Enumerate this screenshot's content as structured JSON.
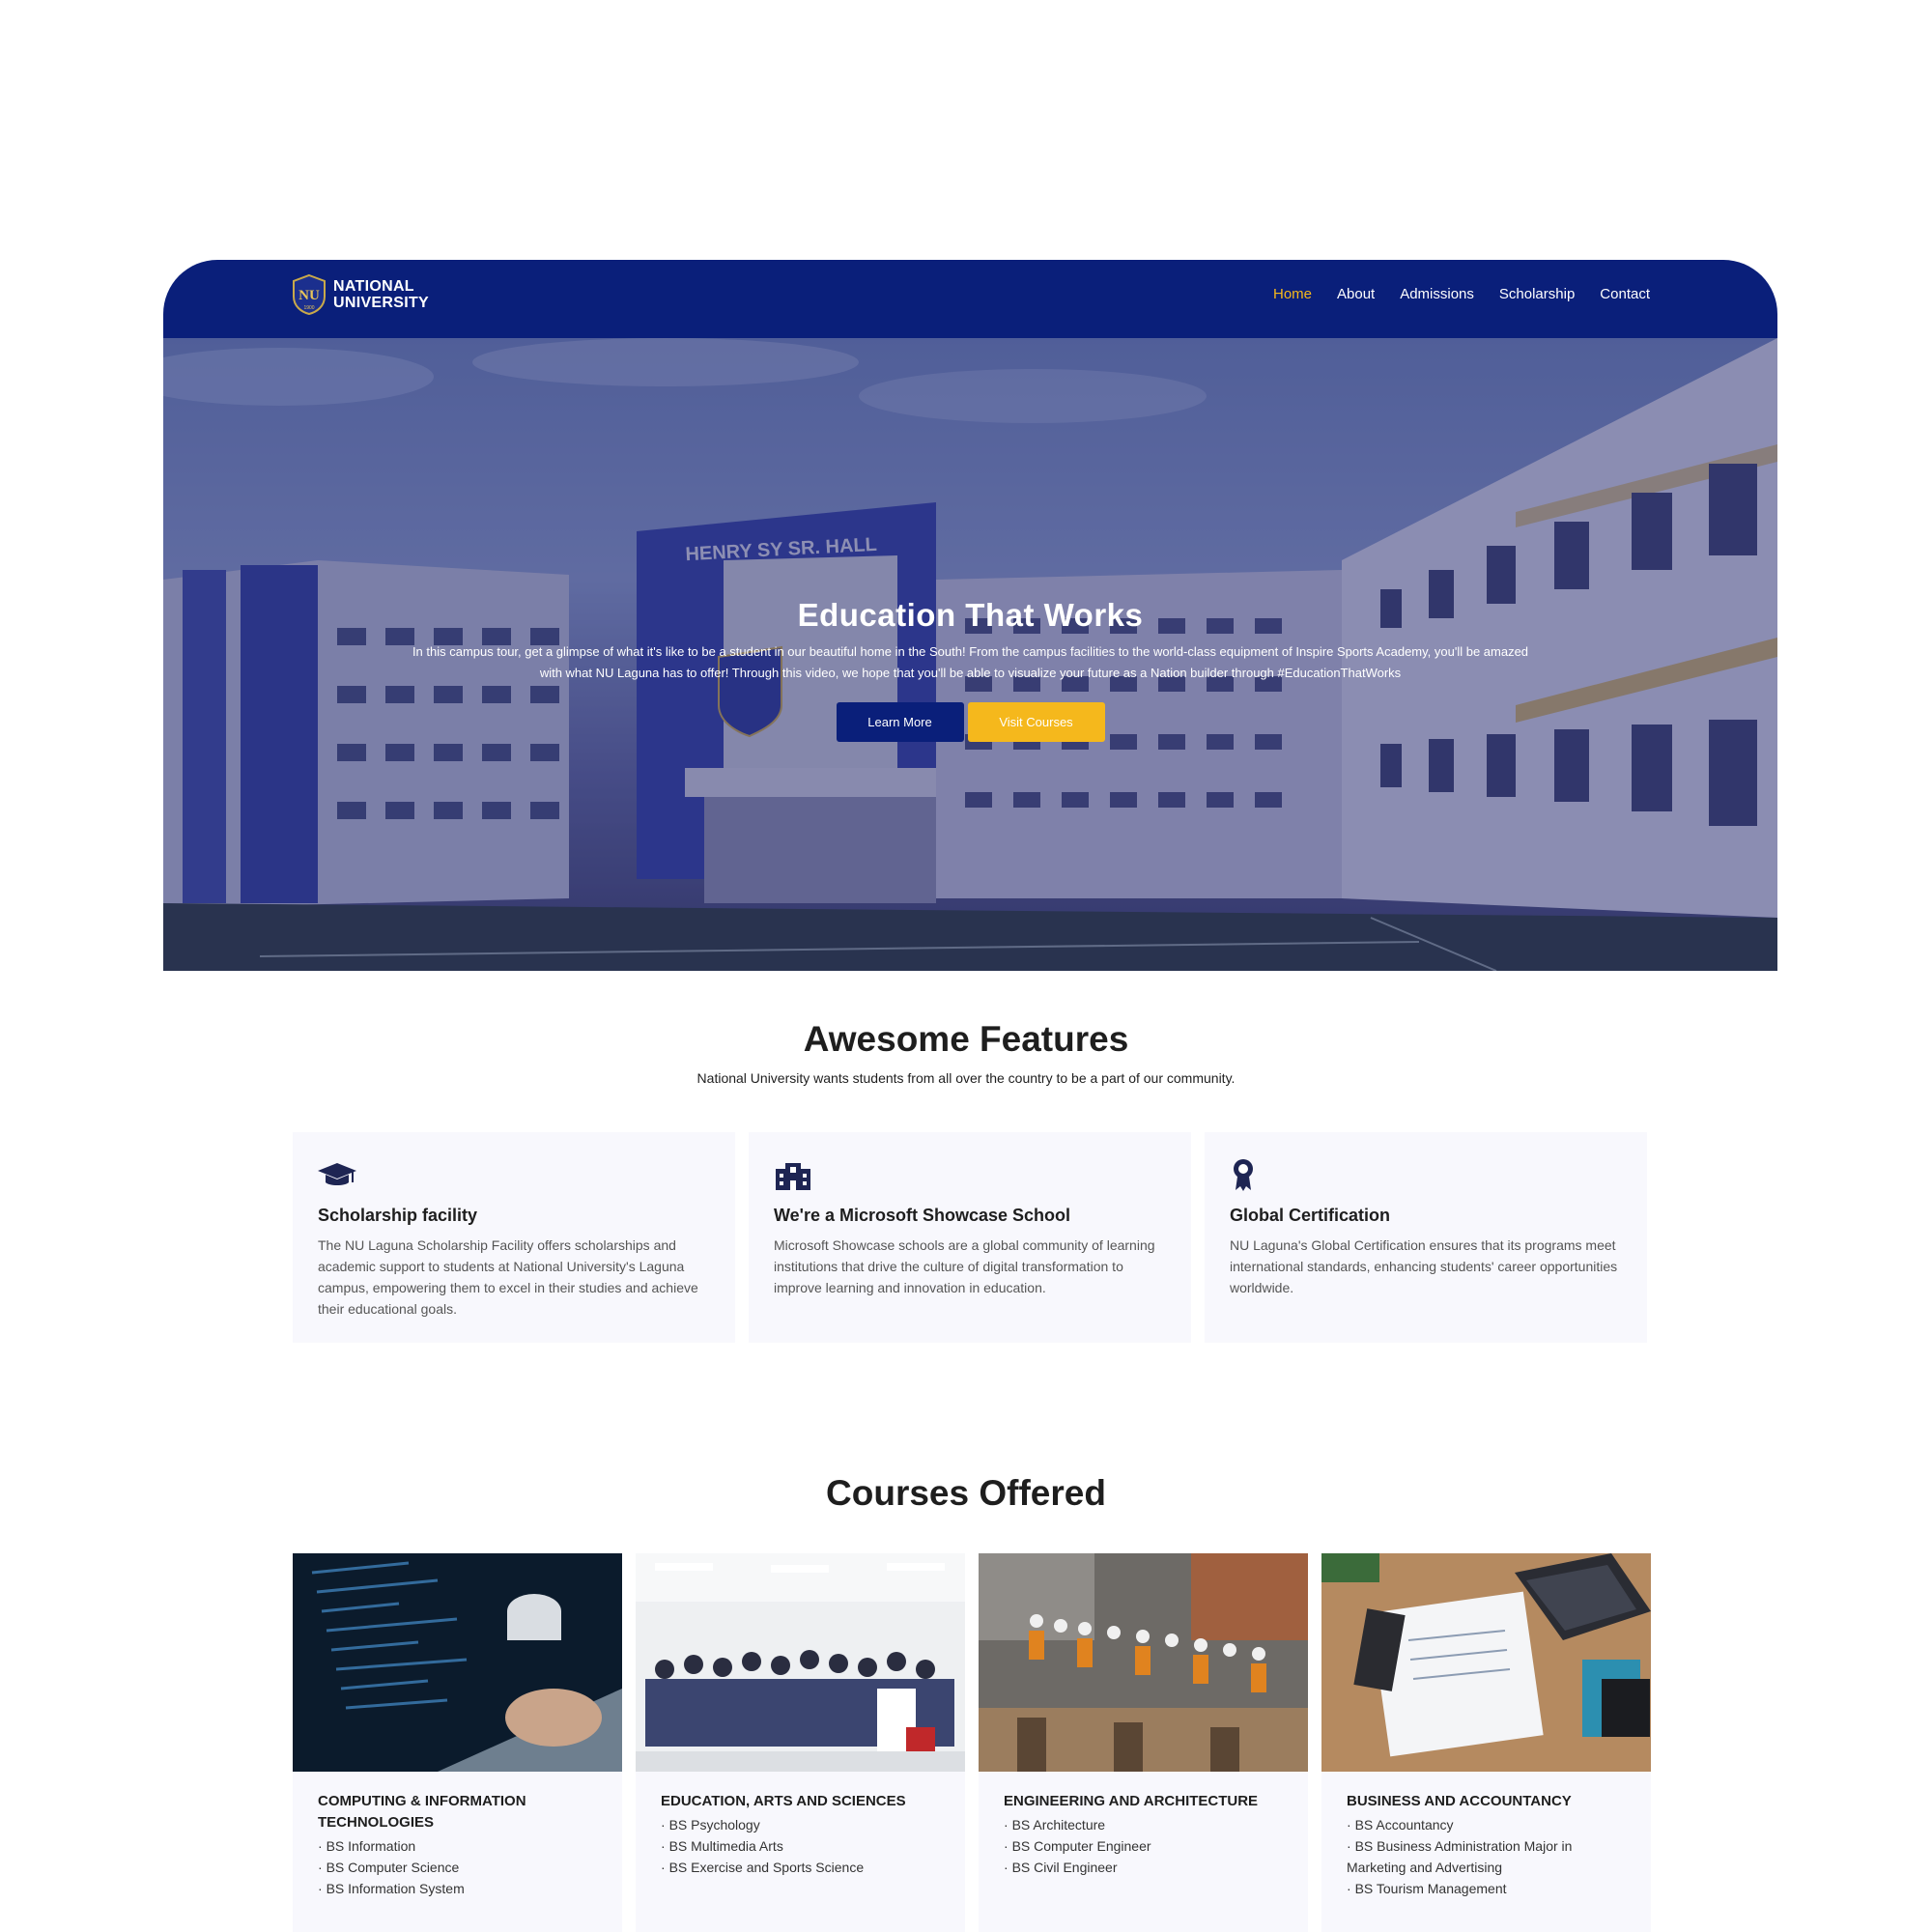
{
  "brand": {
    "line1": "NATIONAL",
    "line2": "UNIVERSITY",
    "logo_letters": "NU",
    "logo_year": "1900"
  },
  "nav": {
    "items": [
      {
        "label": "Home",
        "active": true
      },
      {
        "label": "About",
        "active": false
      },
      {
        "label": "Admissions",
        "active": false
      },
      {
        "label": "Scholarship",
        "active": false
      },
      {
        "label": "Contact",
        "active": false
      }
    ]
  },
  "hero": {
    "building_sign": "HENRY SY SR. HALL",
    "title": "Education That Works",
    "description": "In this campus tour, get a glimpse of what it's like to be a student in our beautiful home in the South! From the campus facilities to the world-class equipment of Inspire Sports Academy, you'll be amazed with what NU Laguna has to offer! Through this video, we hope that you'll be able to visualize your future as a Nation builder through #EducationThatWorks",
    "primary_button": "Learn More",
    "secondary_button": "Visit Courses"
  },
  "features": {
    "title": "Awesome Features",
    "subtitle": "National University wants students from all over the country to be a part of our community.",
    "cards": [
      {
        "icon": "graduation-cap-icon",
        "title": "Scholarship facility",
        "text": "The NU Laguna Scholarship Facility offers scholarships and academic support to students at National University's Laguna campus, empowering them to excel in their studies and achieve their educational goals."
      },
      {
        "icon": "school-building-icon",
        "title": "We're a Microsoft Showcase School",
        "text": "Microsoft Showcase schools are a global community of learning institutions that drive the culture of digital transformation to improve learning and innovation in education."
      },
      {
        "icon": "award-ribbon-icon",
        "title": "Global Certification",
        "text": "NU Laguna's Global Certification ensures that its programs meet international standards, enhancing students' career opportunities worldwide."
      }
    ]
  },
  "courses": {
    "title": "Courses Offered",
    "cards": [
      {
        "title": "COMPUTING & INFORMATION TECHNOLOGIES",
        "items": [
          "BS Information",
          "BS Computer Science",
          "BS Information System"
        ]
      },
      {
        "title": "EDUCATION, ARTS AND SCIENCES",
        "items": [
          "BS Psychology",
          "BS Multimedia Arts",
          "BS Exercise and Sports Science"
        ]
      },
      {
        "title": "ENGINEERING AND ARCHITECTURE",
        "items": [
          "BS Architecture",
          "BS Computer Engineer",
          "BS Civil Engineer"
        ]
      },
      {
        "title": "BUSINESS AND ACCOUNTANCY",
        "items": [
          "BS Accountancy",
          "BS Business Administration Major in Marketing and Advertising",
          "BS Tourism Management"
        ]
      }
    ]
  },
  "colors": {
    "brand_navy": "#0a1f7a",
    "accent_gold": "#f5b81c",
    "card_bg": "#f8f8fd"
  }
}
